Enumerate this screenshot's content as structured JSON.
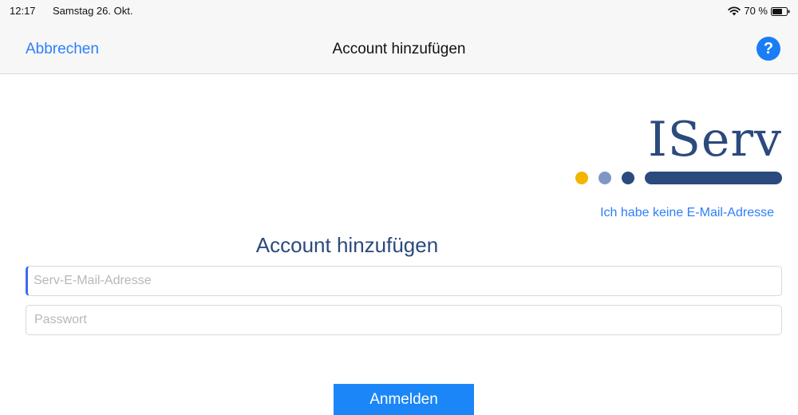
{
  "status_bar": {
    "time": "12:17",
    "date": "Samstag 26. Okt.",
    "battery": "70 %",
    "icons": [
      "wifi-icon",
      "battery-icon"
    ]
  },
  "nav": {
    "cancel_label": "Abbrechen",
    "title": "Account hinzufügen",
    "help_label": "?",
    "help_icon": "question-mark-icon"
  },
  "logo": {
    "text": "IServ",
    "colors": {
      "text": "#2b4a7d",
      "dot_yellow": "#f4b400",
      "dot_lightblue": "#7f97c6",
      "dot_darkblue": "#2b4a7d",
      "bar": "#2b4a7d"
    }
  },
  "links": {
    "no_email": "Ich habe keine E-Mail-Adresse"
  },
  "form": {
    "title": "Account hinzufügen",
    "email": {
      "value": "",
      "placeholder": "Serv-E-Mail-Adresse"
    },
    "password": {
      "value": "",
      "placeholder": "Passwort"
    },
    "submit_label": "Anmelden"
  },
  "colors": {
    "accent": "#2d7ff9",
    "button": "#1b86f7",
    "title": "#2b4a7d"
  }
}
